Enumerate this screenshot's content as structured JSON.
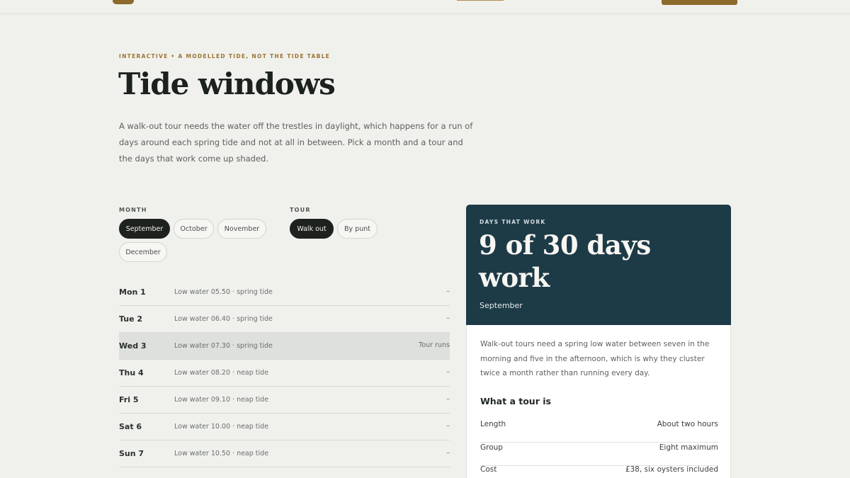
{
  "page": {
    "eyebrow": "INTERACTIVE • A MODELLED TIDE, NOT THE TIDE TABLE",
    "title": "Tide windows",
    "intro": "A walk-out tour needs the water off the trestles in daylight, which happens for a run of days around each spring tide and not at all in between. Pick a month and a tour and the days that work come up shaded."
  },
  "filters": {
    "month_label": "MONTH",
    "months": [
      "September",
      "October",
      "November",
      "December"
    ],
    "selected_month": "September",
    "tour_label": "TOUR",
    "tours": [
      "Walk out",
      "By punt"
    ],
    "selected_tour": "Walk out"
  },
  "days": [
    {
      "day": "Mon 1",
      "detail": "Low water 05.50 · spring tide",
      "status": "–",
      "works": false
    },
    {
      "day": "Tue 2",
      "detail": "Low water 06.40 · spring tide",
      "status": "–",
      "works": false
    },
    {
      "day": "Wed 3",
      "detail": "Low water 07.30 · spring tide",
      "status": "Tour runs",
      "works": true
    },
    {
      "day": "Thu 4",
      "detail": "Low water 08.20 · neap tide",
      "status": "–",
      "works": false
    },
    {
      "day": "Fri 5",
      "detail": "Low water 09.10 · neap tide",
      "status": "–",
      "works": false
    },
    {
      "day": "Sat 6",
      "detail": "Low water 10.00 · neap tide",
      "status": "–",
      "works": false
    },
    {
      "day": "Sun 7",
      "detail": "Low water 10.50 · neap tide",
      "status": "–",
      "works": false
    }
  ],
  "summary": {
    "eyebrow": "DAYS THAT WORK",
    "headline": "9 of 30 days work",
    "month": "September",
    "note": "Walk-out tours need a spring low water between seven in the morning and five in the afternoon, which is why they cluster twice a month rather than running every day.",
    "subheading": "What a tour is",
    "specs": [
      {
        "label": "Length",
        "value": "About two hours"
      },
      {
        "label": "Group",
        "value": "Eight maximum"
      },
      {
        "label": "Cost",
        "value": "£38, six oysters included"
      }
    ]
  },
  "colors": {
    "accent": "#8c6a2c",
    "card_dark": "#1d3a47",
    "active_pill": "#1d221f",
    "working_row": "#dde0dc"
  }
}
